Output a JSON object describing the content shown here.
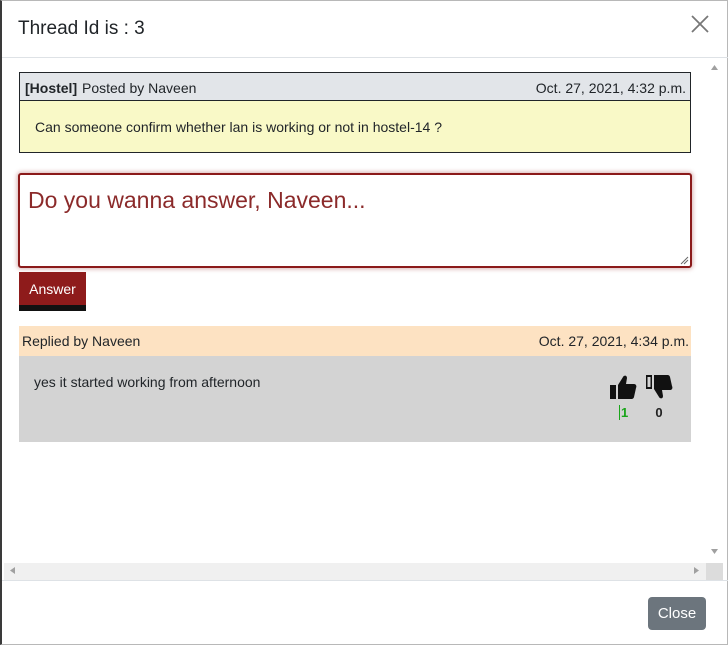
{
  "modal": {
    "title": "Thread Id is : 3"
  },
  "thread": {
    "category": "[Hostel]",
    "posted_by": "Posted by Naveen",
    "date": "Oct. 27, 2021, 4:32 p.m.",
    "question": "Can someone confirm whether lan is working or not in hostel-14 ?"
  },
  "answer_form": {
    "placeholder": "Do you wanna answer, Naveen...",
    "button_label": "Answer"
  },
  "replies": [
    {
      "replied_by": "Replied by Naveen",
      "date": "Oct. 27, 2021, 4:34 p.m.",
      "text": "yes it started working from afternoon",
      "upvotes": "1",
      "downvotes": "0"
    }
  ],
  "footer": {
    "close_label": "Close"
  },
  "icons": {
    "close": "close-icon",
    "upvote": "thumbs-up-icon",
    "downvote": "thumbs-down-icon"
  },
  "colors": {
    "accent": "#8e1b1b",
    "thread_header_bg": "#e2e5e9",
    "thread_body_bg": "#f9f9c7",
    "reply_header_bg": "#fde2c2",
    "reply_body_bg": "#d3d3d3",
    "upvote_count": "#1aa51a",
    "close_button_bg": "#6c757d"
  }
}
